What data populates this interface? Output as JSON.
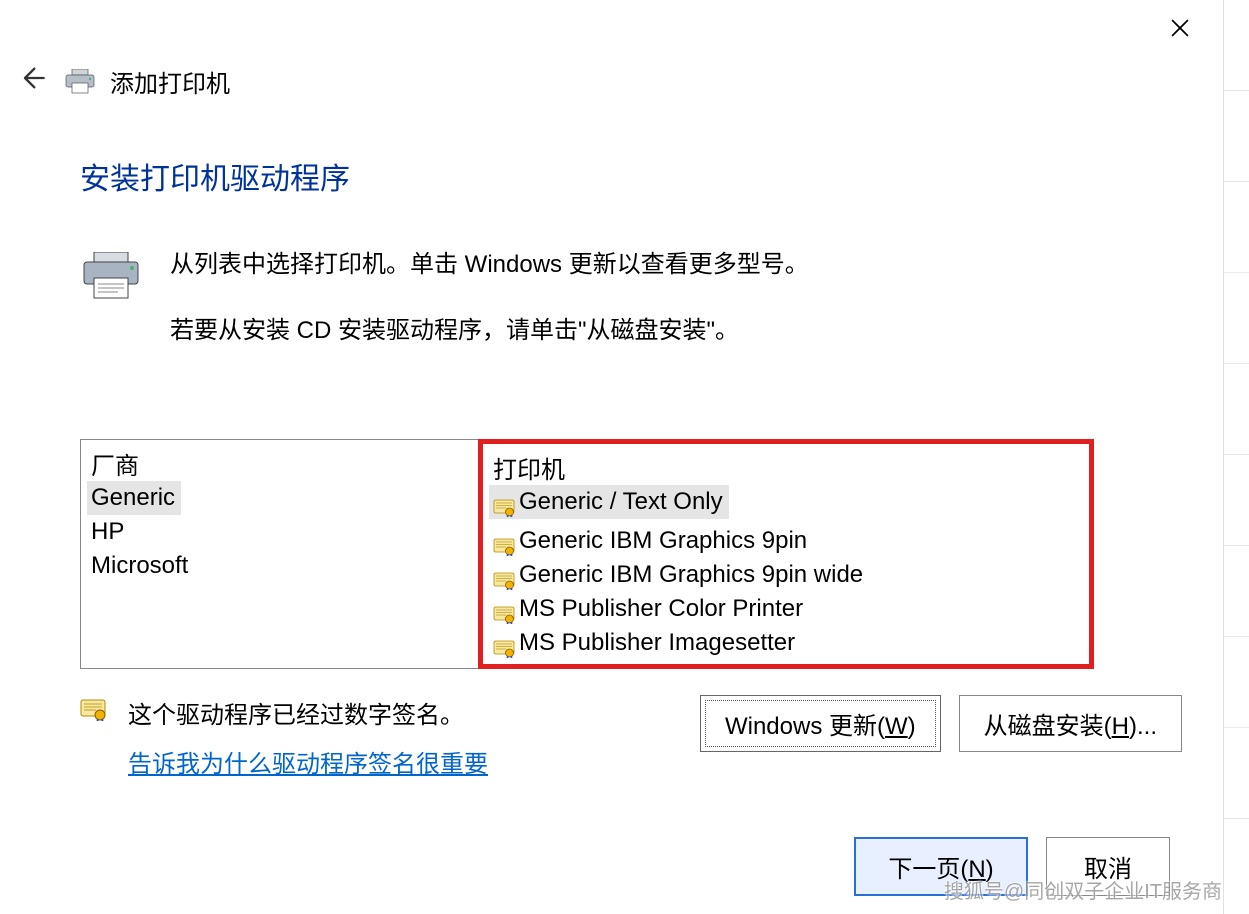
{
  "header": {
    "title": "添加打印机"
  },
  "section": {
    "heading": "安装打印机驱动程序",
    "desc1": "从列表中选择打印机。单击 Windows 更新以查看更多型号。",
    "desc2": "若要从安装 CD 安装驱动程序，请单击\"从磁盘安装\"。"
  },
  "manufacturers": {
    "header": "厂商",
    "items": [
      "Generic",
      "HP",
      "Microsoft"
    ],
    "selected": 0
  },
  "printers": {
    "header": "打印机",
    "items": [
      "Generic / Text Only",
      "Generic IBM Graphics 9pin",
      "Generic IBM Graphics 9pin wide",
      "MS Publisher Color Printer",
      "MS Publisher Imagesetter"
    ],
    "selected": 0
  },
  "signature": {
    "text": "这个驱动程序已经过数字签名。",
    "link": "告诉我为什么驱动程序签名很重要"
  },
  "buttons": {
    "windows_update": "Windows 更新(",
    "windows_update_mnemonic": "W",
    "windows_update_suffix": ")",
    "from_disk": "从磁盘安装(",
    "from_disk_mnemonic": "H",
    "from_disk_suffix": ")...",
    "next": "下一页(",
    "next_mnemonic": "N",
    "next_suffix": ")",
    "cancel": "取消"
  },
  "watermark": "搜狐号@同创双子企业IT服务商"
}
